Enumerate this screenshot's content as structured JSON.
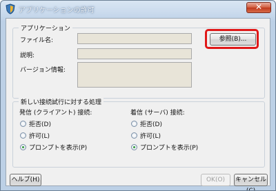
{
  "window": {
    "title": "アプリケーションの許可",
    "close_glyph": "✕"
  },
  "application_group": {
    "title": "アプリケーション",
    "file_name_label": "ファイル名:",
    "description_label": "説明:",
    "version_label": "バージョン情報:",
    "browse_button": "参照(B)..."
  },
  "connection_group": {
    "title": "新しい接続試行に対する処理",
    "outgoing": {
      "title": "発信 (クライアント) 接続:",
      "options": [
        "拒否(D)",
        "許可(L)",
        "プロンプトを表示(P)"
      ],
      "selected": "プロンプトを表示(P)"
    },
    "incoming": {
      "title": "着信 (サーバ) 接続:",
      "options": [
        "拒否(D)",
        "許可(L)",
        "プロンプトを表示(P)"
      ],
      "selected": "プロンプトを表示(P)"
    }
  },
  "footer": {
    "help_button": "ヘルプ(H)",
    "ok_button": "OK(O)",
    "cancel_button": "キャンセル(C)"
  },
  "colors": {
    "highlight": "#e01818",
    "radio_selected": "#2f9a3a"
  }
}
